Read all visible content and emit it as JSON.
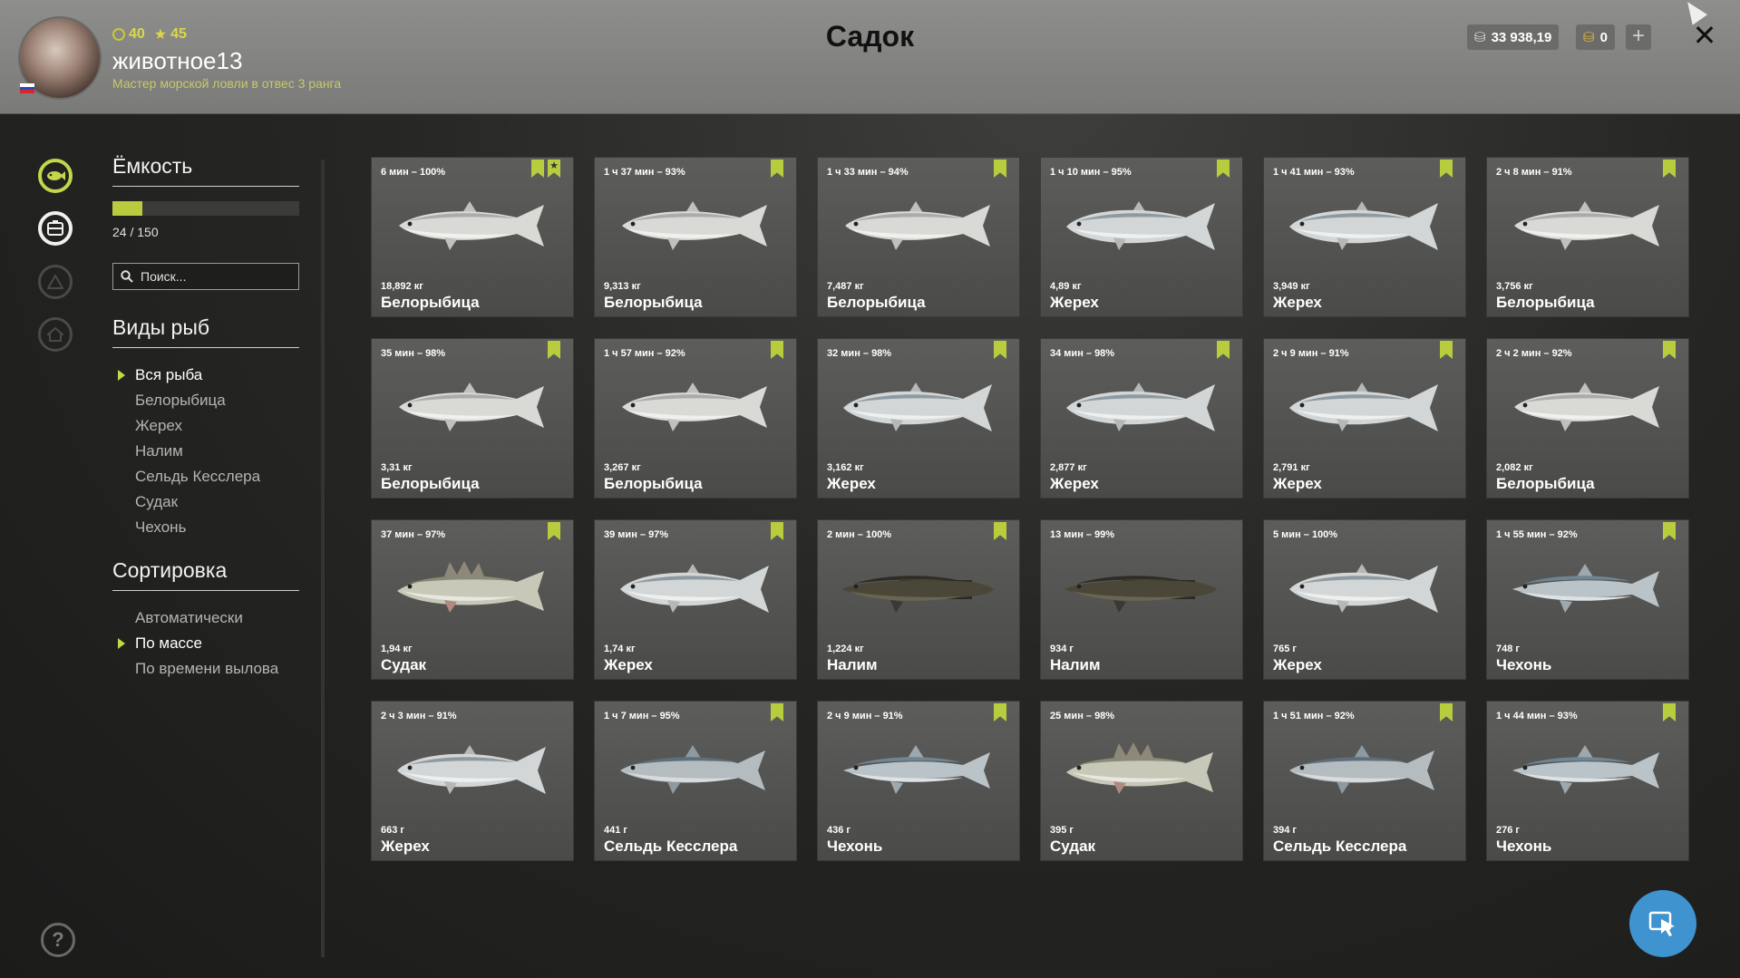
{
  "header": {
    "title": "Садок",
    "player": {
      "level": "40",
      "stars": "45",
      "username": "животное13",
      "rank": "Мастер морской ловли в отвес 3 ранга"
    },
    "currency": {
      "silver": "33 938,19",
      "gold": "0"
    }
  },
  "sidebar": {
    "capacity_title": "Ёмкость",
    "capacity_text": "24 / 150",
    "capacity_fraction": 0.16,
    "search_placeholder": "Поиск...",
    "species_title": "Виды рыб",
    "species": [
      "Вся рыба",
      "Белорыбица",
      "Жерех",
      "Налим",
      "Сельдь Кесслера",
      "Судак",
      "Чехонь"
    ],
    "species_selected": 0,
    "sort_title": "Сортировка",
    "sort_options": [
      "Автоматически",
      "По массе",
      "По времени вылова"
    ],
    "sort_selected": 1
  },
  "accent_color": "#b8cc3e",
  "fish": [
    {
      "time": "6 мин – 100%",
      "weight": "18,892 кг",
      "name": "Белорыбица",
      "bookmark": true,
      "star": true,
      "kind": "whitefish"
    },
    {
      "time": "1 ч 37 мин – 93%",
      "weight": "9,313 кг",
      "name": "Белорыбица",
      "bookmark": true,
      "star": false,
      "kind": "whitefish"
    },
    {
      "time": "1 ч 33 мин – 94%",
      "weight": "7,487 кг",
      "name": "Белорыбица",
      "bookmark": true,
      "star": false,
      "kind": "whitefish"
    },
    {
      "time": "1 ч 10 мин – 95%",
      "weight": "4,89 кг",
      "name": "Жерех",
      "bookmark": true,
      "star": false,
      "kind": "asp"
    },
    {
      "time": "1 ч 41 мин – 93%",
      "weight": "3,949 кг",
      "name": "Жерех",
      "bookmark": true,
      "star": false,
      "kind": "asp"
    },
    {
      "time": "2 ч 8 мин – 91%",
      "weight": "3,756 кг",
      "name": "Белорыбица",
      "bookmark": true,
      "star": false,
      "kind": "whitefish"
    },
    {
      "time": "35 мин – 98%",
      "weight": "3,31 кг",
      "name": "Белорыбица",
      "bookmark": true,
      "star": false,
      "kind": "whitefish"
    },
    {
      "time": "1 ч 57 мин – 92%",
      "weight": "3,267 кг",
      "name": "Белорыбица",
      "bookmark": true,
      "star": false,
      "kind": "whitefish"
    },
    {
      "time": "32 мин – 98%",
      "weight": "3,162 кг",
      "name": "Жерех",
      "bookmark": true,
      "star": false,
      "kind": "asp"
    },
    {
      "time": "34 мин – 98%",
      "weight": "2,877 кг",
      "name": "Жерех",
      "bookmark": true,
      "star": false,
      "kind": "asp"
    },
    {
      "time": "2 ч 9 мин – 91%",
      "weight": "2,791 кг",
      "name": "Жерех",
      "bookmark": true,
      "star": false,
      "kind": "asp"
    },
    {
      "time": "2 ч 2 мин – 92%",
      "weight": "2,082 кг",
      "name": "Белорыбица",
      "bookmark": true,
      "star": false,
      "kind": "whitefish"
    },
    {
      "time": "37 мин – 97%",
      "weight": "1,94 кг",
      "name": "Судак",
      "bookmark": true,
      "star": false,
      "kind": "zander"
    },
    {
      "time": "39 мин – 97%",
      "weight": "1,74 кг",
      "name": "Жерех",
      "bookmark": true,
      "star": false,
      "kind": "asp"
    },
    {
      "time": "2 мин – 100%",
      "weight": "1,224 кг",
      "name": "Налим",
      "bookmark": true,
      "star": false,
      "kind": "burbot"
    },
    {
      "time": "13 мин – 99%",
      "weight": "934 г",
      "name": "Налим",
      "bookmark": false,
      "star": false,
      "kind": "burbot"
    },
    {
      "time": "5 мин – 100%",
      "weight": "765 г",
      "name": "Жерех",
      "bookmark": false,
      "star": false,
      "kind": "asp"
    },
    {
      "time": "1 ч 55 мин – 92%",
      "weight": "748 г",
      "name": "Чехонь",
      "bookmark": true,
      "star": false,
      "kind": "sabrefish"
    },
    {
      "time": "2 ч 3 мин – 91%",
      "weight": "663 г",
      "name": "Жерех",
      "bookmark": false,
      "star": false,
      "kind": "asp"
    },
    {
      "time": "1 ч 7 мин – 95%",
      "weight": "441 г",
      "name": "Сельдь Кесслера",
      "bookmark": true,
      "star": false,
      "kind": "herring"
    },
    {
      "time": "2 ч 9 мин – 91%",
      "weight": "436 г",
      "name": "Чехонь",
      "bookmark": true,
      "star": false,
      "kind": "sabrefish"
    },
    {
      "time": "25 мин – 98%",
      "weight": "395 г",
      "name": "Судак",
      "bookmark": false,
      "star": false,
      "kind": "zander"
    },
    {
      "time": "1 ч 51 мин – 92%",
      "weight": "394 г",
      "name": "Сельдь Кесслера",
      "bookmark": true,
      "star": false,
      "kind": "herring"
    },
    {
      "time": "1 ч 44 мин – 93%",
      "weight": "276 г",
      "name": "Чехонь",
      "bookmark": true,
      "star": false,
      "kind": "sabrefish"
    }
  ]
}
